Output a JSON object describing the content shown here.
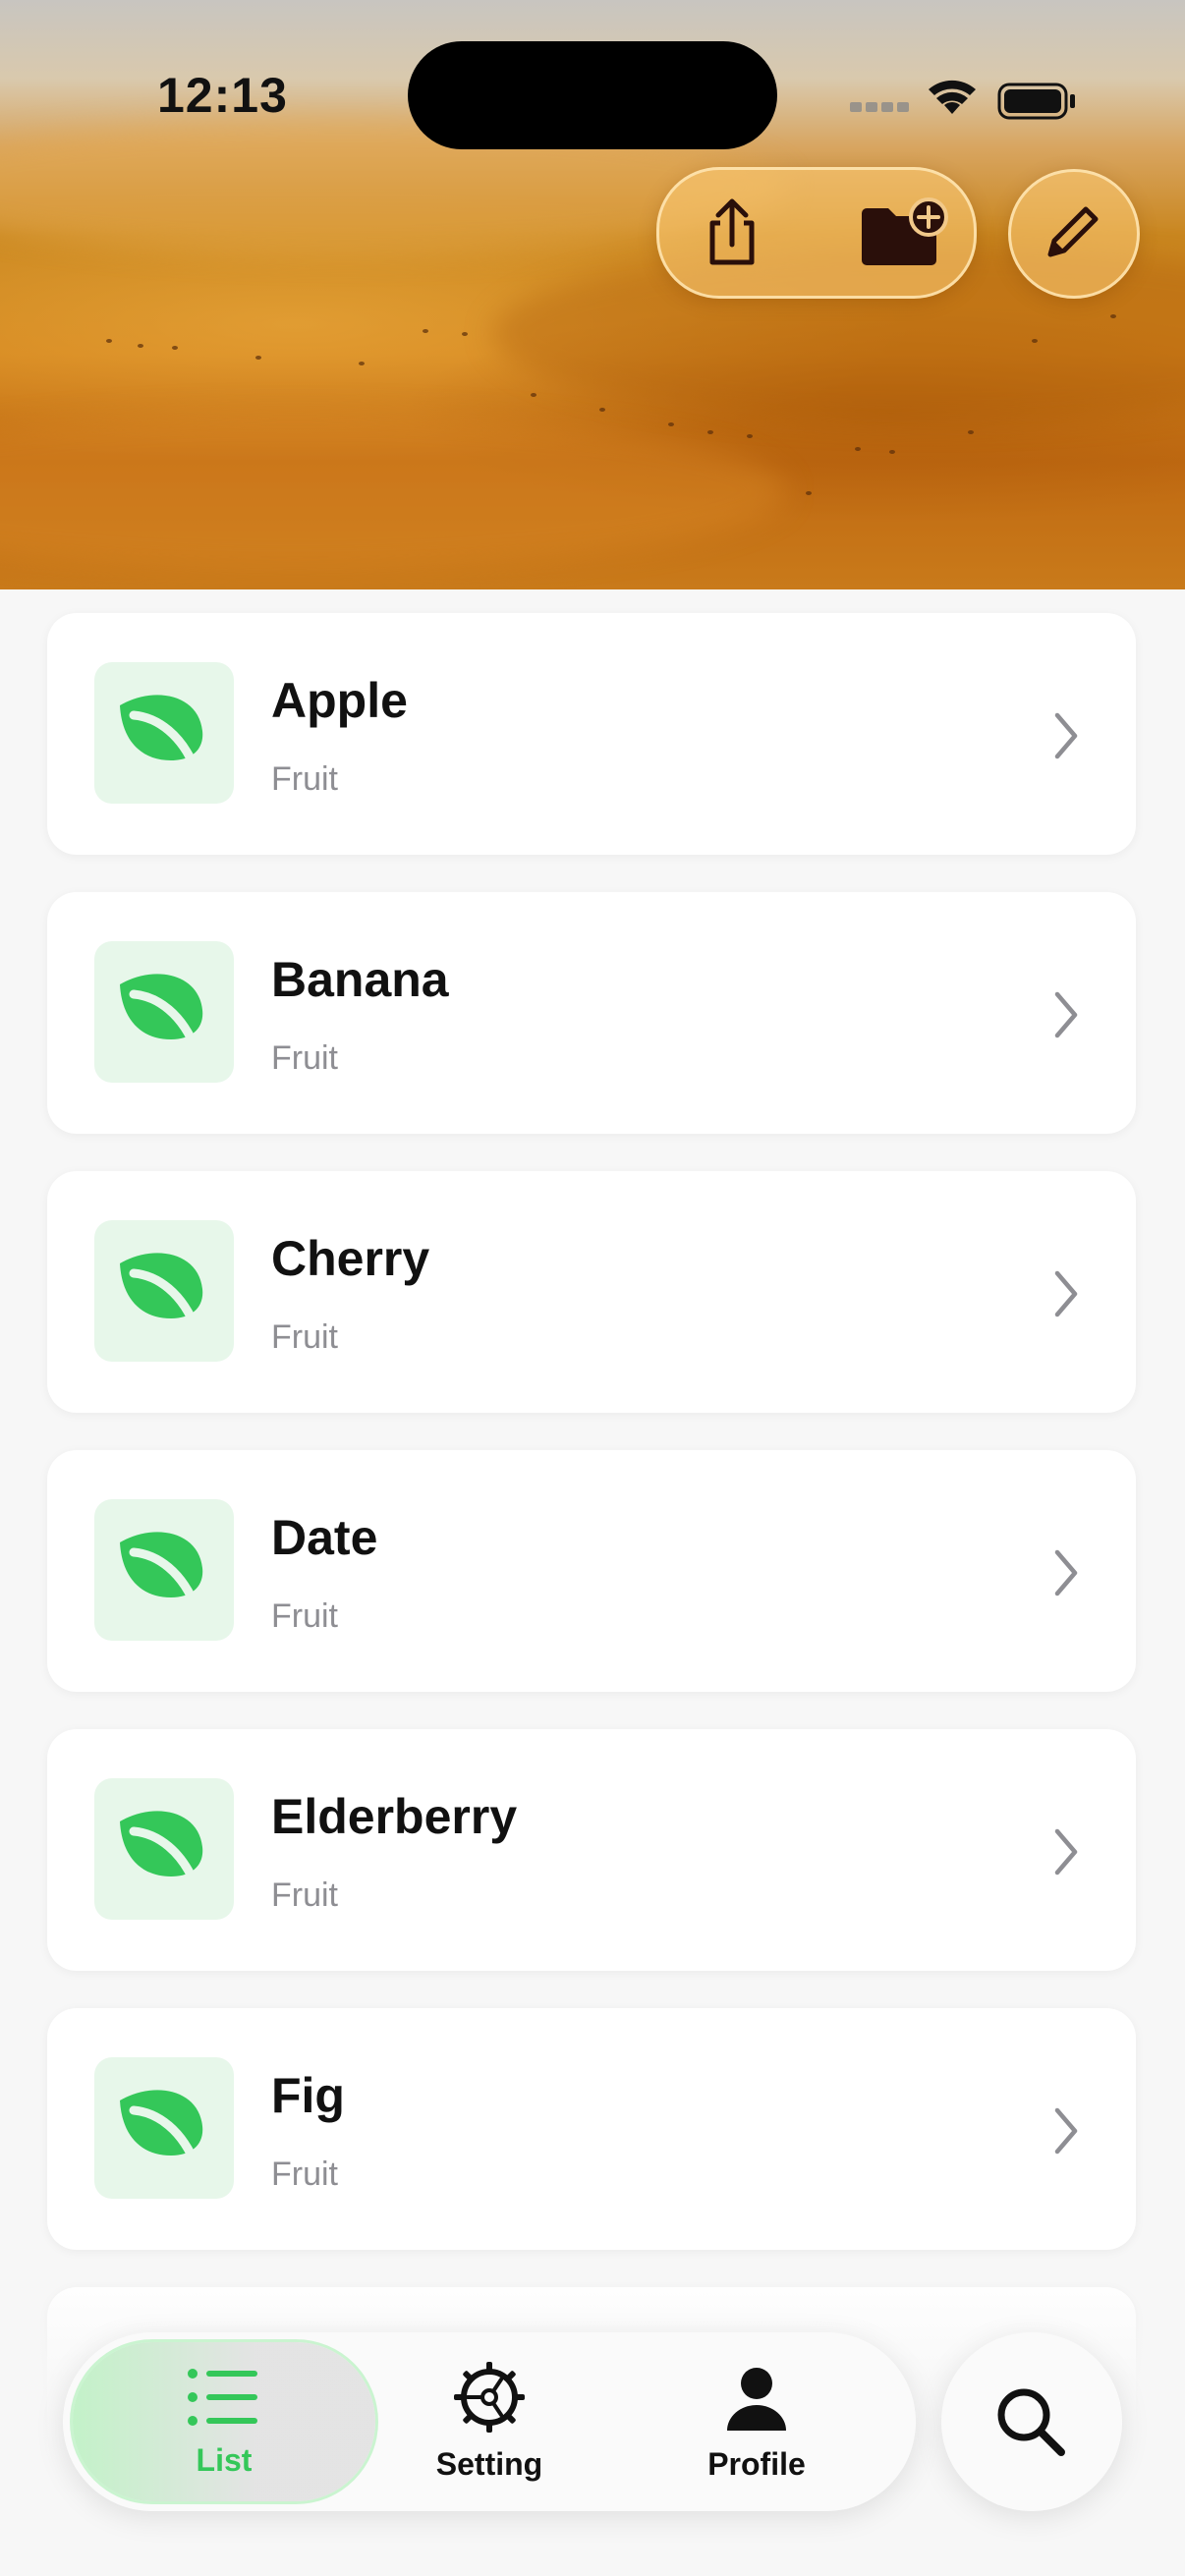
{
  "status_bar": {
    "time": "12:13"
  },
  "header_actions": [
    {
      "name": "share-button",
      "icon": "share-icon"
    },
    {
      "name": "new-folder-button",
      "icon": "folder-badge-plus-icon"
    },
    {
      "name": "edit-button",
      "icon": "pencil-icon"
    }
  ],
  "items": [
    {
      "title": "Apple",
      "subtitle": "Fruit"
    },
    {
      "title": "Banana",
      "subtitle": "Fruit"
    },
    {
      "title": "Cherry",
      "subtitle": "Fruit"
    },
    {
      "title": "Date",
      "subtitle": "Fruit"
    },
    {
      "title": "Elderberry",
      "subtitle": "Fruit"
    },
    {
      "title": "Fig",
      "subtitle": "Fruit"
    }
  ],
  "tabbar": {
    "tabs": [
      {
        "label": "List",
        "icon": "list-bullet-icon",
        "active": true
      },
      {
        "label": "Setting",
        "icon": "gear-icon",
        "active": false
      },
      {
        "label": "Profile",
        "icon": "person-icon",
        "active": false
      }
    ],
    "search_icon": "magnifying-glass-icon"
  },
  "colors": {
    "accent": "#34c759",
    "leaf_bg": "#e7f7ea",
    "header_tint": "#c9861f"
  }
}
